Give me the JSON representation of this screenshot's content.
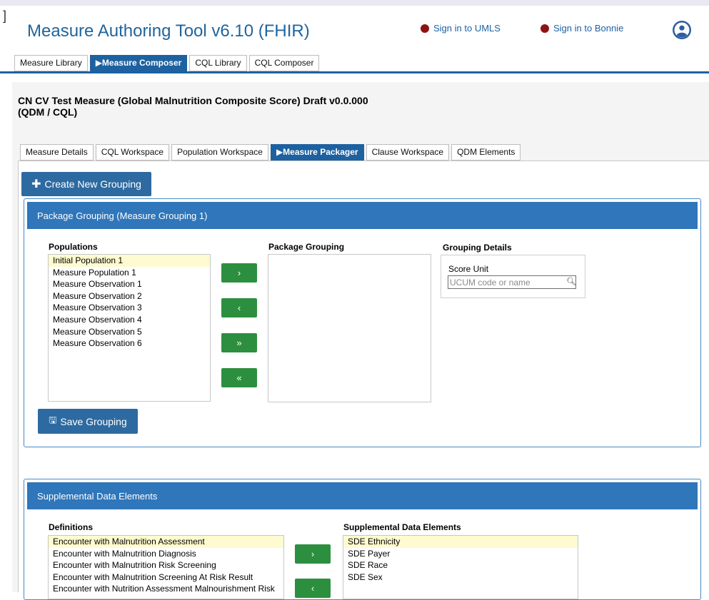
{
  "app": {
    "title": "Measure Authoring Tool v6.10 (FHIR)",
    "bracket": "]",
    "sign_in_umls": "Sign in to UMLS",
    "sign_in_bonnie": "Sign in to Bonnie",
    "status_dot_color": "#8e1414"
  },
  "main_tabs": [
    {
      "label": "Measure Library"
    },
    {
      "label": "▶Measure Composer"
    },
    {
      "label": "CQL Library"
    },
    {
      "label": "CQL Composer"
    }
  ],
  "measure": {
    "title_line1": "CN CV Test Measure (Global Malnutrition Composite Score) Draft v0.0.000",
    "title_line2": "(QDM / CQL)"
  },
  "sub_tabs": [
    {
      "label": "Measure Details"
    },
    {
      "label": "CQL Workspace"
    },
    {
      "label": "Population Workspace"
    },
    {
      "label": "▶Measure Packager"
    },
    {
      "label": "Clause Workspace"
    },
    {
      "label": "QDM Elements"
    }
  ],
  "buttons": {
    "create_grouping": "Create New Grouping",
    "save_grouping": "Save Grouping",
    "add_one": "›",
    "remove_one": "‹",
    "add_all": "»",
    "remove_all": "«"
  },
  "package_panel": {
    "header": "Package Grouping (Measure Grouping 1)",
    "populations_label": "Populations",
    "populations": [
      "Initial Population 1",
      "Measure Population 1",
      "Measure Observation 1",
      "Measure Observation 2",
      "Measure Observation 3",
      "Measure Observation 4",
      "Measure Observation 5",
      "Measure Observation 6"
    ],
    "package_grouping_label": "Package Grouping",
    "grouping_details_label": "Grouping Details",
    "score_unit_label": "Score Unit",
    "score_unit_placeholder": "UCUM code or name"
  },
  "sde_panel": {
    "header": "Supplemental Data Elements",
    "definitions_label": "Definitions",
    "definitions": [
      "Encounter with Malnutrition Assessment",
      "Encounter with Malnutrition Diagnosis",
      "Encounter with Malnutrition Risk Screening",
      "Encounter with Malnutrition Screening At Risk Result",
      "Encounter with Nutrition Assessment Malnourishment Risk"
    ],
    "sde_label": "Supplemental Data Elements",
    "sde_items": [
      "SDE Ethnicity",
      "SDE Payer",
      "SDE Race",
      "SDE Sex"
    ]
  },
  "colors": {
    "primary_blue": "#1e61a0",
    "panel_header_blue": "#2f76ba",
    "button_green": "#2c8f3f",
    "selected_yellow": "#fffbd0"
  }
}
